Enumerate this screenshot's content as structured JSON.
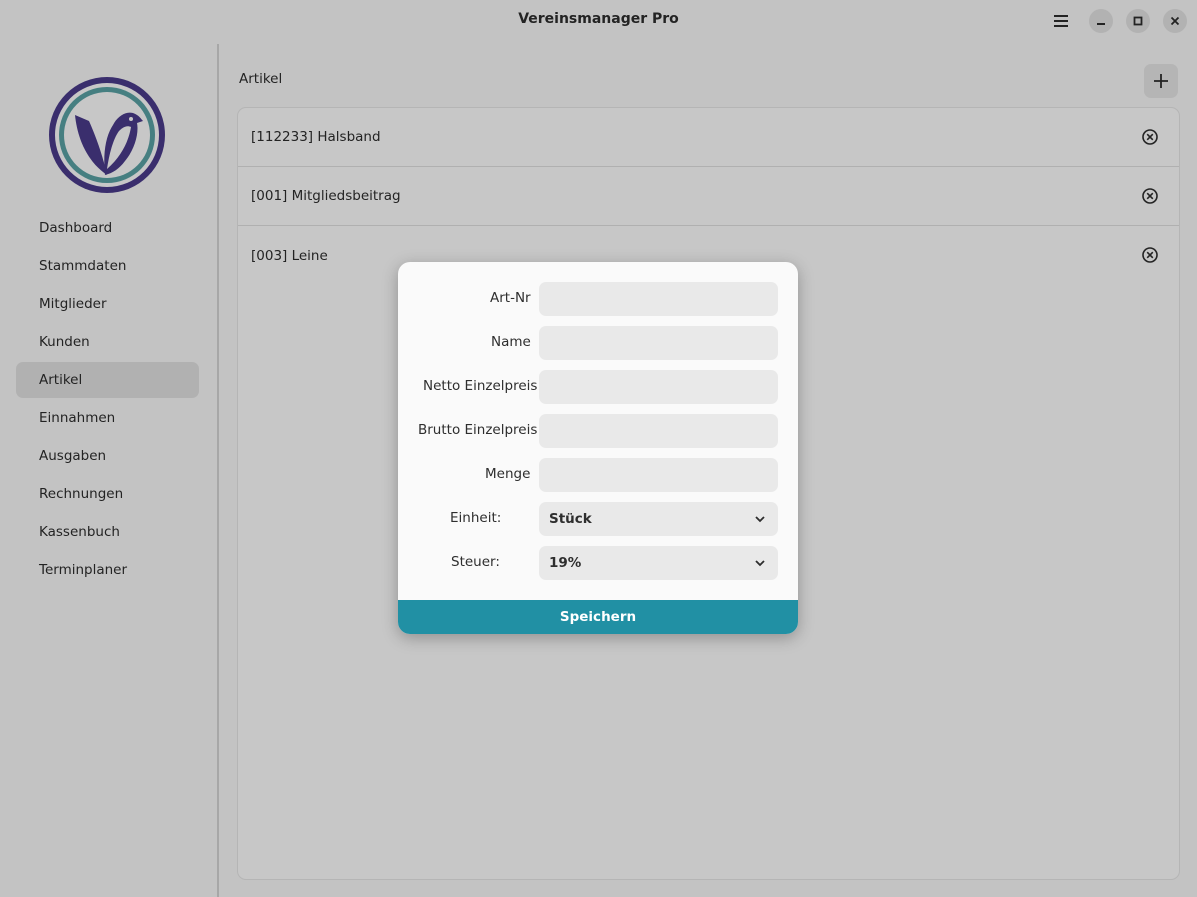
{
  "window": {
    "title": "Vereinsmanager Pro"
  },
  "icons": {
    "menu": "hamburger-menu-icon",
    "minimize": "minimize-icon",
    "maximize": "maximize-icon",
    "close": "close-icon",
    "add": "plus-icon",
    "delete": "circle-x-icon",
    "dropdown": "chevron-down-icon"
  },
  "colors": {
    "accent": "#2190a4",
    "logo_ring": "#4b3c8c",
    "logo_inner": "#5aa3a6"
  },
  "sidebar": {
    "items": [
      {
        "label": "Dashboard"
      },
      {
        "label": "Stammdaten"
      },
      {
        "label": "Mitglieder"
      },
      {
        "label": "Kunden"
      },
      {
        "label": "Artikel",
        "active": true
      },
      {
        "label": "Einnahmen"
      },
      {
        "label": "Ausgaben"
      },
      {
        "label": "Rechnungen"
      },
      {
        "label": "Kassenbuch"
      },
      {
        "label": "Terminplaner"
      }
    ]
  },
  "main": {
    "title": "Artikel",
    "articles": [
      {
        "label": "[112233] Halsband"
      },
      {
        "label": "[001] Mitgliedsbeitrag"
      },
      {
        "label": "[003] Leine"
      }
    ]
  },
  "dialog": {
    "fields": {
      "art_nr": {
        "label": "Art-Nr",
        "value": ""
      },
      "name": {
        "label": "Name",
        "value": ""
      },
      "netto": {
        "label": "Netto Einzelpreis",
        "value": ""
      },
      "brutto": {
        "label": "Brutto Einzelpreis",
        "value": ""
      },
      "menge": {
        "label": "Menge",
        "value": ""
      }
    },
    "einheit": {
      "label": "Einheit:",
      "value": "Stück"
    },
    "steuer": {
      "label": "Steuer:",
      "value": "19%"
    },
    "save_label": "Speichern"
  }
}
